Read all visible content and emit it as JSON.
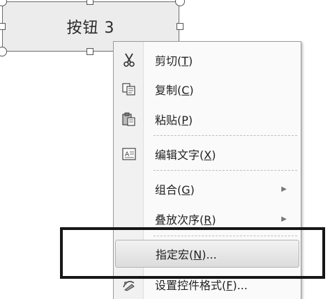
{
  "form_button": {
    "label": "按钮 3"
  },
  "context_menu": {
    "items": [
      {
        "text": "剪切(",
        "key": "T",
        "end": ")",
        "icon": "scissors-icon"
      },
      {
        "text": "复制(",
        "key": "C",
        "end": ")",
        "icon": "copy-icon"
      },
      {
        "text": "粘贴(",
        "key": "P",
        "end": ")",
        "icon": "paste-icon"
      },
      {
        "text": "编辑文字(",
        "key": "X",
        "end": ")",
        "icon": "edit-text-icon"
      },
      {
        "text": "组合(",
        "key": "G",
        "end": ")",
        "submenu_arrow": "▶"
      },
      {
        "text": "叠放次序(",
        "key": "R",
        "end": ")",
        "submenu_arrow": "▶"
      },
      {
        "text": "指定宏(",
        "key": "N",
        "end": ")...",
        "state": "highlighted"
      },
      {
        "text": "设置控件格式(",
        "key": "F",
        "end": ")...",
        "icon": "format-control-icon"
      }
    ]
  },
  "colors": {
    "annotation_border": "#161616",
    "highlight_bg": "#dcdcdc",
    "menu_bg": "#fafafa"
  }
}
